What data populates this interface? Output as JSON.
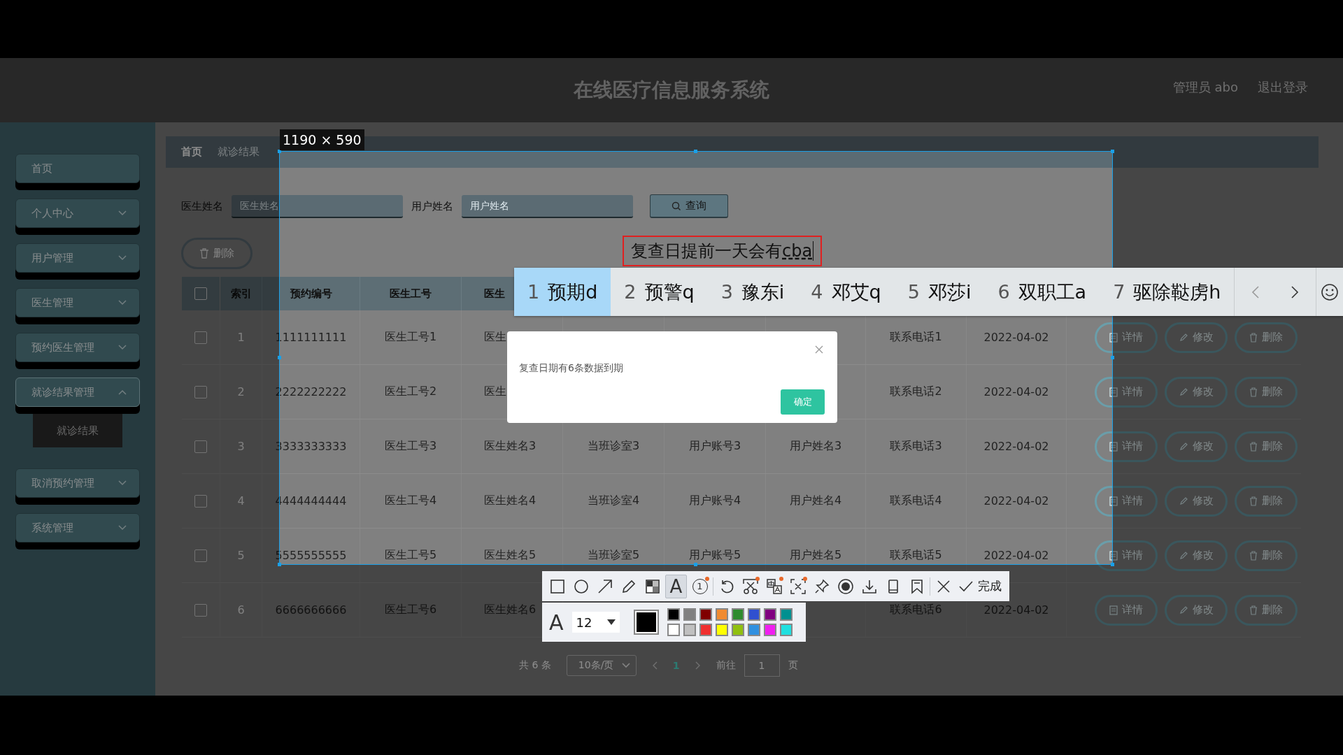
{
  "app": {
    "title": "在线医疗信息服务系统",
    "user": "管理员 abo",
    "logout": "退出登录"
  },
  "sidebar": [
    {
      "label": "首页",
      "expandable": false,
      "expanded": false
    },
    {
      "label": "个人中心",
      "expandable": true,
      "expanded": false
    },
    {
      "label": "用户管理",
      "expandable": true,
      "expanded": false
    },
    {
      "label": "医生管理",
      "expandable": true,
      "expanded": false
    },
    {
      "label": "预约医生管理",
      "expandable": true,
      "expanded": false
    },
    {
      "label": "就诊结果管理",
      "expandable": true,
      "expanded": true,
      "children": [
        {
          "label": "就诊结果",
          "selected": true
        }
      ]
    },
    {
      "label": "取消预约管理",
      "expandable": true,
      "expanded": false
    },
    {
      "label": "系统管理",
      "expandable": true,
      "expanded": false
    }
  ],
  "breadcrumb": [
    "首页",
    "就诊结果"
  ],
  "filters": [
    {
      "label": "医生姓名",
      "placeholder": "医生姓名"
    },
    {
      "label": "用户姓名",
      "placeholder": "用户姓名"
    }
  ],
  "search_button": "查询",
  "delete_button": "删除",
  "table": {
    "select_all_checked": false,
    "columns": [
      "索引",
      "预约编号",
      "医生工号",
      "医生"
    ],
    "rows": [
      {
        "checked": false,
        "cells": [
          "1",
          "1111111111",
          "医生工号1",
          "医生",
          null,
          null,
          null,
          "联系电话1",
          "2022-04-02"
        ],
        "actions": [
          "详情",
          "修改",
          "删除"
        ]
      },
      {
        "checked": false,
        "cells": [
          "2",
          "2222222222",
          "医生工号2",
          "医生",
          null,
          null,
          null,
          "联系电话2",
          "2022-04-02"
        ],
        "actions": [
          "详情",
          "修改",
          "删除"
        ]
      },
      {
        "checked": false,
        "cells": [
          "3",
          "3333333333",
          "医生工号3",
          "医生姓名3",
          "当班诊室3",
          "用户账号3",
          "用户姓名3",
          "联系电话3",
          "2022-04-02"
        ],
        "actions": [
          "详情",
          "修改",
          "删除"
        ]
      },
      {
        "checked": false,
        "cells": [
          "4",
          "4444444444",
          "医生工号4",
          "医生姓名4",
          "当班诊室4",
          "用户账号4",
          "用户姓名4",
          "联系电话4",
          "2022-04-02"
        ],
        "actions": [
          "详情",
          "修改",
          "删除"
        ]
      },
      {
        "checked": false,
        "cells": [
          "5",
          "5555555555",
          "医生工号5",
          "医生姓名5",
          "当班诊室5",
          "用户账号5",
          "用户姓名5",
          "联系电话5",
          "2022-04-02"
        ],
        "actions": [
          "详情",
          "修改",
          "删除"
        ]
      },
      {
        "checked": false,
        "cells": [
          "6",
          "6666666666",
          "医生工号6",
          "医生姓名6",
          null,
          null,
          null,
          "联系电话6",
          "2022-04-02"
        ],
        "actions": [
          "详情",
          "修改",
          "删除"
        ]
      }
    ]
  },
  "pagination": {
    "total": "共 6 条",
    "page_size": "10条/页",
    "pages": [
      {
        "label": "1",
        "selected": true
      }
    ],
    "goto_label": "前往",
    "goto_value": "1",
    "goto_suffix": "页"
  },
  "dialog": {
    "message": "复查日期有6条数据到期",
    "confirm": "确定"
  },
  "capture": {
    "size_label": "1190 × 590",
    "annotation": {
      "text": "复查日提前一天会有",
      "composing": "cba"
    },
    "tool_groups": [
      [
        {
          "kind": "rect",
          "selected": false,
          "badge": false
        },
        {
          "kind": "ellipse",
          "selected": false,
          "badge": false
        },
        {
          "kind": "arrow",
          "selected": false,
          "badge": false
        },
        {
          "kind": "pencil",
          "selected": false,
          "badge": false
        },
        {
          "kind": "mosaic",
          "selected": false,
          "badge": false
        },
        {
          "kind": "text",
          "glyph": "A",
          "selected": true,
          "badge": false
        },
        {
          "kind": "number",
          "glyph": "1",
          "selected": false,
          "badge": true
        }
      ],
      [
        {
          "kind": "undo",
          "selected": false,
          "badge": false
        },
        {
          "kind": "cut",
          "selected": false,
          "badge": true
        },
        {
          "kind": "translate",
          "selected": false,
          "badge": true
        },
        {
          "kind": "scan",
          "selected": false,
          "badge": true
        },
        {
          "kind": "pin",
          "selected": false,
          "badge": false
        },
        {
          "kind": "record",
          "selected": false,
          "badge": false
        },
        {
          "kind": "save",
          "selected": false,
          "badge": false
        },
        {
          "kind": "phone",
          "selected": false,
          "badge": false
        },
        {
          "kind": "bookmark",
          "selected": false,
          "badge": false
        }
      ],
      [
        {
          "kind": "close",
          "selected": false,
          "badge": false
        },
        {
          "kind": "done",
          "label": "完成"
        }
      ]
    ],
    "font_glyph": "A",
    "font_size": "12",
    "current": {
      "color": "#000000"
    },
    "palette": [
      {
        "color": "#000000"
      },
      {
        "color": "#808080"
      },
      {
        "color": "#800000"
      },
      {
        "color": "#f08a30"
      },
      {
        "color": "#2e8b2e"
      },
      {
        "color": "#3050d0"
      },
      {
        "color": "#800080"
      },
      {
        "color": "#009090"
      },
      {
        "color": "#ffffff"
      },
      {
        "color": "#c0c0c0"
      },
      {
        "color": "#f03030"
      },
      {
        "color": "#ffff00"
      },
      {
        "color": "#90c010"
      },
      {
        "color": "#3090e0"
      },
      {
        "color": "#f020f0"
      },
      {
        "color": "#20e0e0"
      }
    ]
  },
  "ime": {
    "candidates": [
      {
        "index": "1",
        "text": "预期d",
        "selected": true
      },
      {
        "index": "2",
        "text": "预警q",
        "selected": false
      },
      {
        "index": "3",
        "text": "豫东i",
        "selected": false
      },
      {
        "index": "4",
        "text": "邓艾q",
        "selected": false
      },
      {
        "index": "5",
        "text": "邓莎i",
        "selected": false
      },
      {
        "index": "6",
        "text": "双职工a",
        "selected": false
      },
      {
        "index": "7",
        "text": "驱除鞑虏h",
        "selected": false
      }
    ]
  }
}
